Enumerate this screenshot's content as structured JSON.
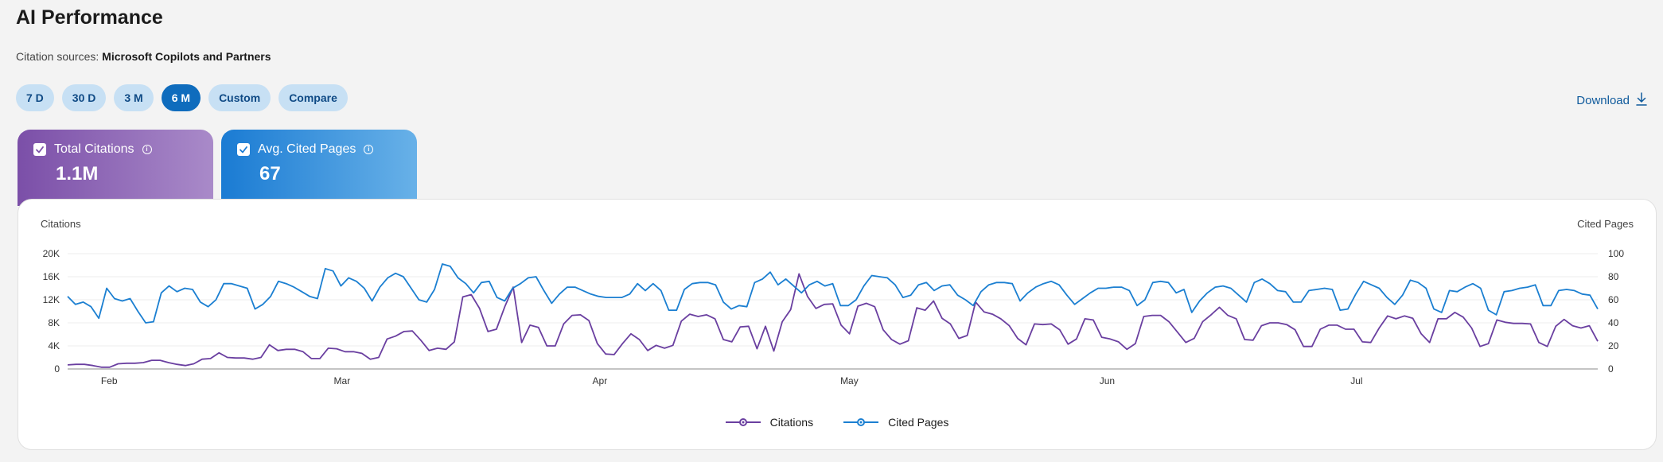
{
  "header": {
    "title": "AI Performance",
    "sources_label": "Citation sources:",
    "sources_value": "Microsoft Copilots and Partners"
  },
  "ranges": {
    "items": [
      "7 D",
      "30 D",
      "3 M",
      "6 M",
      "Custom",
      "Compare"
    ],
    "active": "6 M"
  },
  "download": {
    "label": "Download",
    "icon": "download-icon"
  },
  "cards": {
    "citations": {
      "label": "Total Citations",
      "value": "1.1M",
      "checked": true
    },
    "cited_pages": {
      "label": "Avg. Cited Pages",
      "value": "67",
      "checked": true
    }
  },
  "colors": {
    "citations": "#6a3fa0",
    "cited_pages": "#1b7fd1",
    "active_range": "#0f6cbd",
    "range_bg": "#c7e0f4"
  },
  "chart_data": {
    "type": "line",
    "left_axis_title": "Citations",
    "right_axis_title": "Cited Pages",
    "left_ticks": [
      "0",
      "4K",
      "8K",
      "12K",
      "16K",
      "20K"
    ],
    "right_ticks": [
      "0",
      "20",
      "40",
      "60",
      "80",
      "100"
    ],
    "ylim_left": [
      0,
      20000
    ],
    "ylim_right": [
      0,
      100
    ],
    "x_range": [
      "2025-01-27",
      "2025-07-30"
    ],
    "month_labels": [
      {
        "label": "Feb",
        "date": "2025-02-01"
      },
      {
        "label": "Mar",
        "date": "2025-03-01"
      },
      {
        "label": "Apr",
        "date": "2025-04-01"
      },
      {
        "label": "May",
        "date": "2025-05-01"
      },
      {
        "label": "Jun",
        "date": "2025-06-01"
      },
      {
        "label": "Jul",
        "date": "2025-07-01"
      }
    ],
    "grid": true,
    "legend_position": "bottom-center",
    "series": [
      {
        "name": "Citations",
        "axis": "left",
        "values": [
          700,
          800,
          800,
          600,
          300,
          300,
          900,
          1000,
          1000,
          1100,
          1500,
          1500,
          1100,
          800,
          600,
          900,
          1700,
          1800,
          2800,
          2000,
          1900,
          1900,
          1700,
          2000,
          4200,
          3200,
          3400,
          3400,
          3000,
          1800,
          1800,
          3600,
          3500,
          3000,
          3000,
          2700,
          1700,
          2000,
          5200,
          5700,
          6500,
          6600,
          5000,
          3200,
          3600,
          3400,
          4700,
          12500,
          12900,
          10500,
          6500,
          6900,
          10800,
          14200,
          4600,
          7600,
          7200,
          4000,
          4000,
          7800,
          9300,
          9400,
          8400,
          4400,
          2600,
          2500,
          4400,
          6100,
          5100,
          3200,
          4100,
          3600,
          4100,
          8300,
          9500,
          9100,
          9400,
          8700,
          5100,
          4700,
          7300,
          7400,
          3500,
          7400,
          3100,
          8200,
          10300,
          16500,
          12600,
          10500,
          11200,
          11300,
          7600,
          6100,
          10900,
          11400,
          10800,
          6800,
          5100,
          4300,
          4900,
          10600,
          10200,
          11800,
          8800,
          7800,
          5300,
          5800,
          11600,
          9900,
          9500,
          8700,
          7500,
          5300,
          4200,
          7800,
          7700,
          7800,
          6800,
          4300,
          5200,
          8700,
          8500,
          5500,
          5200,
          4700,
          3400,
          4400,
          9100,
          9300,
          9300,
          8200,
          6400,
          4600,
          5300,
          8200,
          9400,
          10700,
          9300,
          8700,
          5100,
          5000,
          7500,
          8000,
          8000,
          7700,
          6800,
          3900,
          3900,
          6900,
          7600,
          7600,
          6900,
          6900,
          4700,
          4600,
          7100,
          9200,
          8700,
          9200,
          8800,
          6100,
          4600,
          8700,
          8700,
          9800,
          9000,
          7100,
          3900,
          4400,
          8500,
          8100,
          7900,
          7900,
          7800,
          4600,
          3900,
          7400,
          8600,
          7500,
          7100,
          7500,
          4800
        ]
      },
      {
        "name": "Cited Pages",
        "axis": "right",
        "values": [
          63,
          56,
          58,
          54,
          44,
          70,
          61,
          59,
          61,
          50,
          40,
          41,
          66,
          72,
          67,
          70,
          69,
          58,
          54,
          60,
          74,
          74,
          72,
          70,
          52,
          56,
          63,
          76,
          74,
          71,
          67,
          63,
          61,
          87,
          85,
          72,
          79,
          76,
          70,
          59,
          71,
          79,
          83,
          80,
          70,
          60,
          58,
          69,
          91,
          89,
          79,
          74,
          66,
          75,
          76,
          62,
          59,
          70,
          74,
          79,
          80,
          68,
          57,
          65,
          71,
          71,
          68,
          65,
          63,
          62,
          62,
          62,
          65,
          74,
          68,
          74,
          68,
          51,
          51,
          69,
          74,
          75,
          75,
          73,
          58,
          52,
          55,
          54,
          75,
          78,
          84,
          73,
          78,
          72,
          66,
          73,
          76,
          72,
          74,
          55,
          55,
          60,
          72,
          81,
          80,
          79,
          73,
          62,
          64,
          73,
          75,
          68,
          72,
          73,
          64,
          60,
          55,
          67,
          73,
          75,
          75,
          74,
          59,
          66,
          71,
          74,
          76,
          73,
          64,
          56,
          61,
          66,
          70,
          70,
          71,
          71,
          68,
          55,
          60,
          75,
          76,
          75,
          66,
          69,
          49,
          59,
          66,
          71,
          72,
          70,
          64,
          58,
          75,
          78,
          74,
          68,
          67,
          58,
          58,
          68,
          69,
          70,
          69,
          51,
          52,
          65,
          76,
          73,
          70,
          62,
          56,
          64,
          77,
          75,
          70,
          52,
          49,
          68,
          67,
          71,
          74,
          70,
          51,
          47,
          67,
          68,
          70,
          71,
          73,
          55,
          55,
          68,
          69,
          68,
          65,
          64,
          52
        ]
      }
    ]
  },
  "legend": {
    "citations": "Citations",
    "cited_pages": "Cited Pages"
  }
}
